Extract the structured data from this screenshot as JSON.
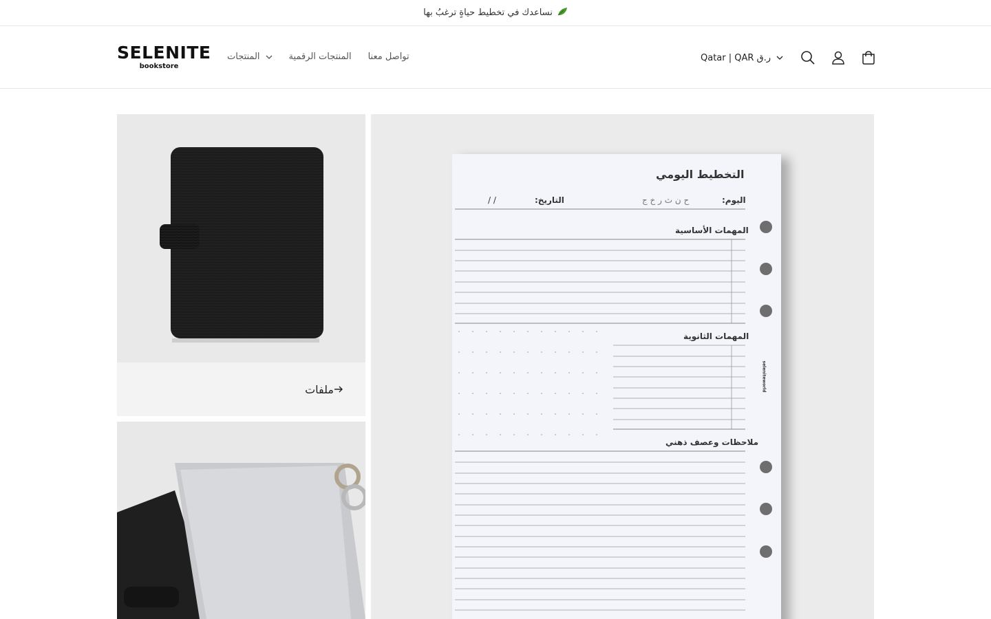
{
  "announcement": {
    "text": "نساعدك في تخطيط حياةٍ ترغبُ بها",
    "icon": "leaf-icon"
  },
  "header": {
    "logo": {
      "brand": "SELENITE",
      "tagline": "bookstore"
    },
    "nav": [
      {
        "label": "المنتجات",
        "has_dropdown": true
      },
      {
        "label": "المنتجات الرقمية",
        "has_dropdown": false
      },
      {
        "label": "تواصل معنا",
        "has_dropdown": false
      }
    ],
    "country_selector": "Qatar | QAR ر.ق",
    "icons": [
      "search-icon",
      "account-icon",
      "cart-icon"
    ]
  },
  "collage": {
    "folder_caption": "ملفات",
    "planner_sheet": {
      "title": "التخطيط اليومي",
      "day_label": "اليوم:",
      "weekdays": "ح ن ث ر خ ج",
      "date_label": "التاريخ:",
      "date_separators": "/     /",
      "main_tasks": "المهمات الأساسية",
      "secondary_tasks": "المهمات الثانوية",
      "notes": "ملاحظات وعصف ذهني",
      "spine_text": "seleniteworld"
    }
  },
  "colors": {
    "accent": "#121212",
    "tile_bg": "#ebebeb",
    "caption_bg": "#f3f3f3",
    "leaf": "#3a8a2e"
  }
}
